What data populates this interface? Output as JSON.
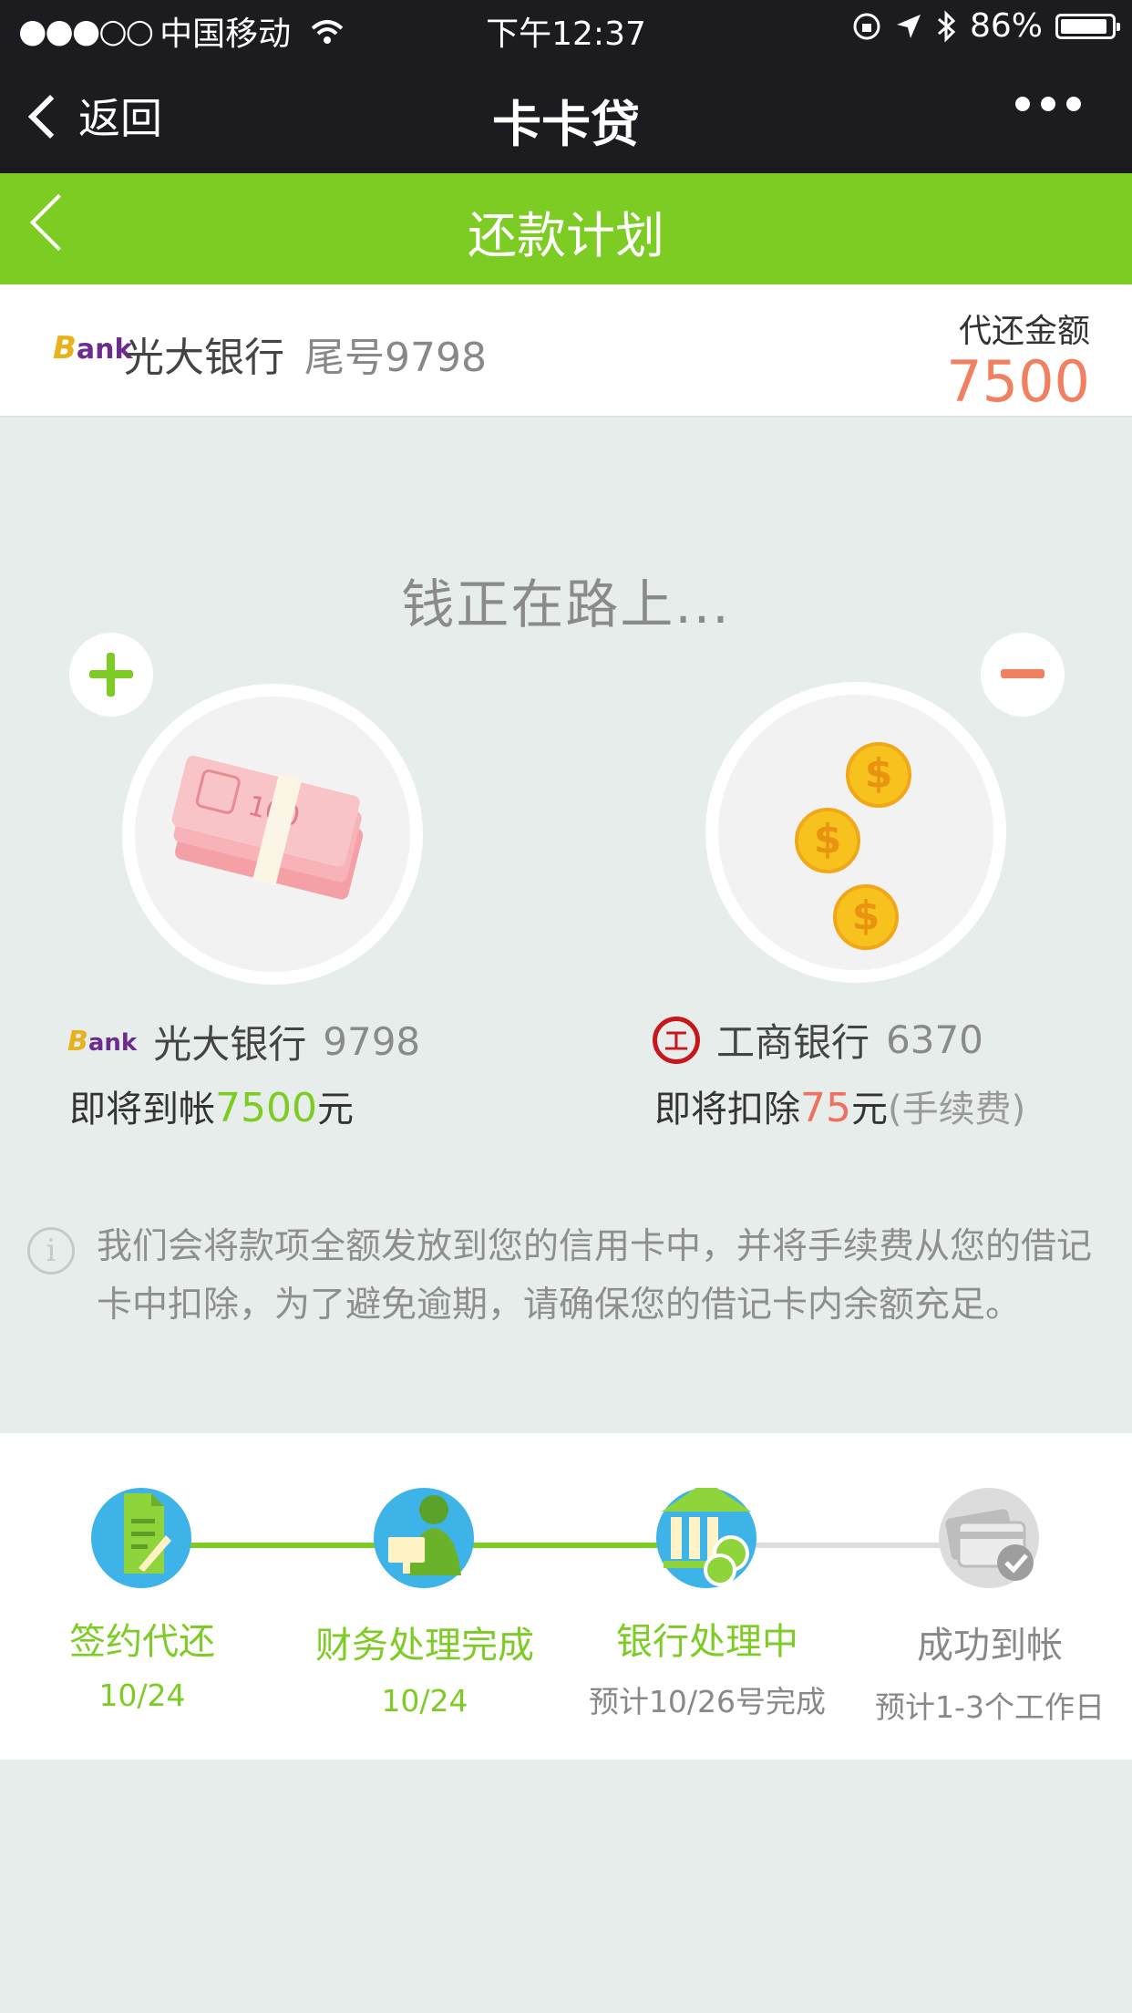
{
  "status_bar": {
    "signal_dots": "●●●○○",
    "carrier": "中国移动",
    "time": "下午12:37",
    "battery": "86%"
  },
  "nav": {
    "back_label": "返回",
    "title": "卡卡贷"
  },
  "header": {
    "title": "还款计划"
  },
  "card": {
    "logo_text_b": "B",
    "logo_text_ank": "ank",
    "bank_name": "光大银行",
    "tail": "尾号9798",
    "amount_label": "代还金额",
    "amount": "7500"
  },
  "transfer": {
    "status": "钱正在路上...",
    "credit": {
      "bank_name": "光大银行",
      "number": "9798",
      "prefix": "即将到帐",
      "amount": "7500",
      "unit": "元"
    },
    "debit": {
      "logo_char": "工",
      "bank_name": "工商银行",
      "number": "6370",
      "prefix": "即将扣除",
      "amount": "75",
      "unit": "元",
      "note": "(手续费)"
    },
    "coin_symbol": "$"
  },
  "notice": {
    "icon_char": "i",
    "text": "我们会将款项全额发放到您的信用卡中，并将手续费从您的借记卡中扣除，为了避免逾期，请确保您的借记卡内余额充足。"
  },
  "steps": [
    {
      "title": "签约代还",
      "date": "10/24",
      "state": "done",
      "icon": "contract-icon"
    },
    {
      "title": "财务处理完成",
      "date": "10/24",
      "state": "done",
      "icon": "finance-icon"
    },
    {
      "title": "银行处理中",
      "date": "预计10/26号完成",
      "state": "current",
      "icon": "bank-icon"
    },
    {
      "title": "成功到帐",
      "date": "预计1-3个工作日",
      "state": "pending",
      "icon": "cards-check-icon"
    }
  ],
  "colors": {
    "accent_green": "#7dcc24",
    "amount_orange": "#f08060",
    "nav_dark": "#1c1c20"
  }
}
